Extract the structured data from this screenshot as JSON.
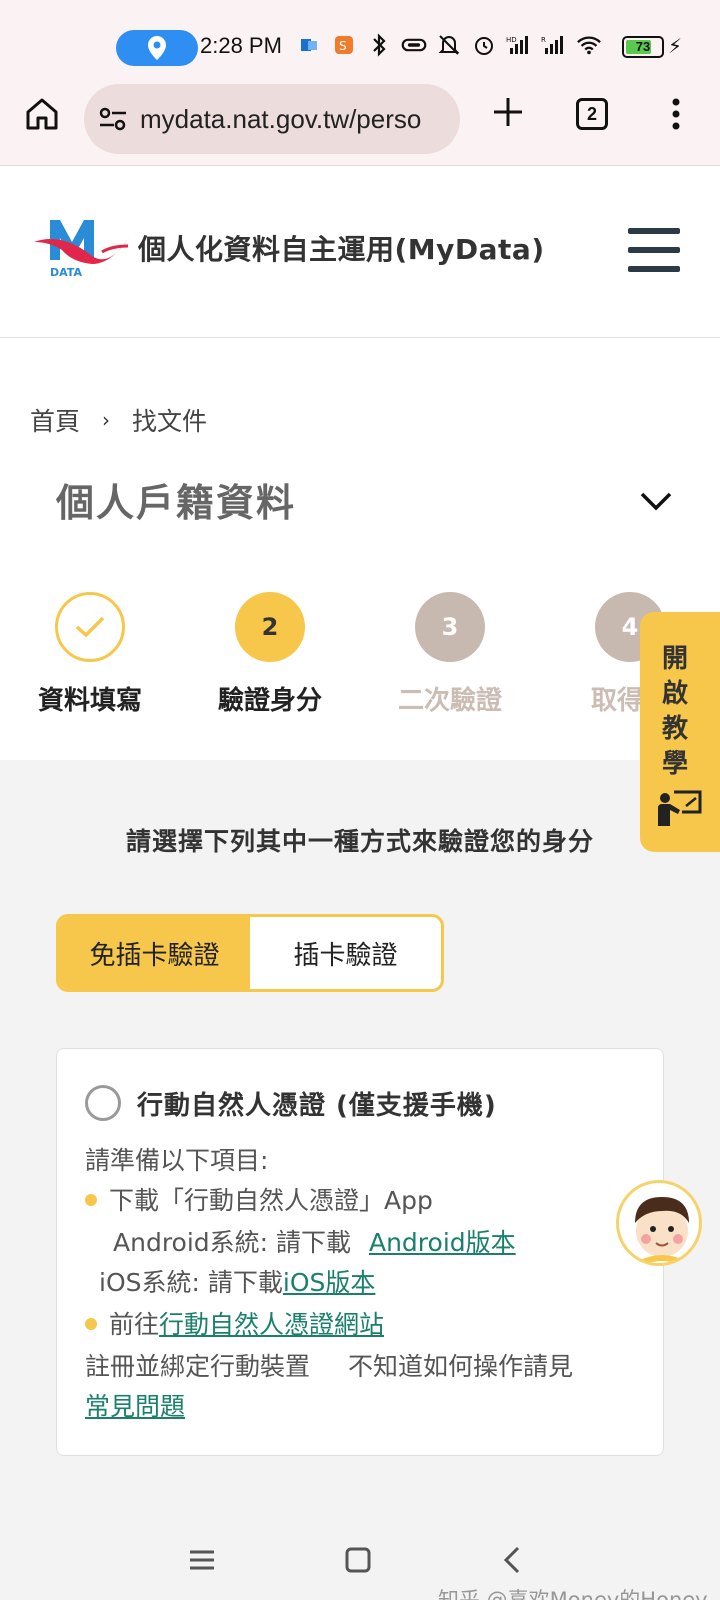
{
  "status_bar": {
    "time": "2:28 PM",
    "battery_level": "73",
    "battery_fraction": 0.73,
    "icons": [
      "location-icon",
      "outlook-icon",
      "app-icon",
      "bluetooth-icon",
      "link-icon",
      "mute-icon",
      "alarm-icon",
      "signal-hd-icon",
      "signal-r-icon",
      "wifi-icon",
      "battery-icon",
      "charging-icon"
    ]
  },
  "browser": {
    "url": "mydata.nat.gov.tw/perso",
    "tab_count": "2"
  },
  "site": {
    "logo_text": "DATA",
    "title": "個人化資料自主運用(MyData)"
  },
  "breadcrumb": {
    "home": "首頁",
    "current": "找文件"
  },
  "page_title": "個人戶籍資料",
  "steps": [
    {
      "number": "1",
      "label": "資料填寫",
      "state": "done"
    },
    {
      "number": "2",
      "label": "驗證身分",
      "state": "current"
    },
    {
      "number": "3",
      "label": "二次驗證",
      "state": "future"
    },
    {
      "number": "4",
      "label": "取得文",
      "state": "future"
    }
  ],
  "tutorial_tab": "開啟教學",
  "instruction": "請選擇下列其中一種方式來驗證您的身分",
  "verify_toggle": {
    "option_no_card": "免插卡驗證",
    "option_card": "插卡驗證"
  },
  "method_card": {
    "title": "行動自然人憑證 (僅支援手機)",
    "prepare": "請準備以下項目:",
    "item1": "下載「行動自然人憑證」App",
    "android_label": "Android系統: 請下載",
    "android_link": "Android版本",
    "ios_label": "iOS系統: 請下載",
    "ios_link": "iOS版本",
    "item2_prefix": "前往",
    "item2_link": "行動自然人憑證網站",
    "register": "註冊並綁定行動裝置",
    "help_text": "不知道如何操作請見",
    "faq_link": "常見問題"
  },
  "watermark": "知乎 @喜欢Money的Honey",
  "colors": {
    "accent": "#f6c74a",
    "link": "#1a7f6b",
    "future_step": "#c8b9b0",
    "header_icon": "#2c3a48"
  }
}
